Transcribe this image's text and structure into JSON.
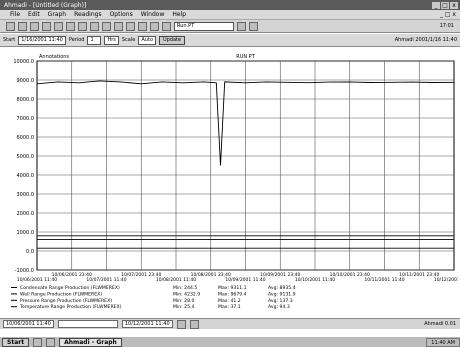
{
  "window": {
    "title": "Ahmadi - [Untitled (Graph)]",
    "minimize_label": "_",
    "maximize_label": "□",
    "close_label": "x"
  },
  "menu": {
    "items": [
      "File",
      "Edit",
      "Graph",
      "Readings",
      "Options",
      "Window",
      "Help"
    ],
    "right_label": "_ □ x"
  },
  "toolbar": {
    "point_field": "Run.PT",
    "time_label": "17:01"
  },
  "params": {
    "start_label": "Start",
    "start_value": "1/16/2001 11:40",
    "period_label": "Period",
    "period_value": "1",
    "period_unit": "Hrs",
    "scale_label": "Scale",
    "scale_value": "Auto",
    "update_button": "Update",
    "right_text": "Ahmadi 2001/1/16 11:40"
  },
  "chart_data": {
    "type": "line",
    "title": "RUN PT",
    "left_title": "Annotations",
    "ylim": [
      -1000,
      10000
    ],
    "yticks": [
      "10000.0",
      "9000.0",
      "8000.0",
      "7000.0",
      "6000.0",
      "5000.0",
      "4000.0",
      "3000.0",
      "2000.0",
      "1000.0",
      "0.0",
      "-1000.0"
    ],
    "xticks_top": [
      "10/06/2001 23:40",
      "10/07/2001 23:40",
      "10/08/2001 23:40",
      "10/09/2001 23:40",
      "10/10/2001 23:40",
      "10/11/2001 23:40"
    ],
    "xticks_bottom": [
      "10/06/2001 11:40",
      "10/07/2001 11:40",
      "10/08/2001 11:40",
      "10/09/2001 11:40",
      "10/10/2001 11:40",
      "10/11/2001 11:40",
      "10/12/2001 11:40"
    ],
    "series": [
      {
        "name": "Condensate Range Production (FLWMEREX)",
        "color": "#000000",
        "x": [
          0,
          0.05,
          0.1,
          0.15,
          0.2,
          0.25,
          0.3,
          0.35,
          0.4,
          0.43,
          0.44,
          0.45,
          0.5,
          0.55,
          0.6,
          0.65,
          0.7,
          0.75,
          0.8,
          0.85,
          0.9,
          0.95,
          1
        ],
        "values": [
          8800,
          8900,
          8850,
          8950,
          8900,
          8800,
          8900,
          8850,
          8900,
          8850,
          4500,
          8900,
          8850,
          8900,
          8880,
          8860,
          8890,
          8900,
          8870,
          8880,
          8890,
          8870,
          8880
        ]
      },
      {
        "name": "Well Range Production (FLWMEREX)",
        "color": "#000000",
        "x": [
          0,
          1
        ],
        "values": [
          800,
          800
        ]
      },
      {
        "name": "Pressure Range Production (FLWMEREX)",
        "color": "#000000",
        "x": [
          0,
          1
        ],
        "values": [
          600,
          600
        ]
      },
      {
        "name": "Temperature Range Production (FLWMEREX)",
        "color": "#000000",
        "x": [
          0,
          1
        ],
        "values": [
          150,
          150
        ]
      }
    ],
    "legend_rows": [
      {
        "name": "Condensate Range Production (FLWMEREX)",
        "min": "Min: 244.5",
        "max": "Max: 9311.1",
        "avg": "Avg: 8935.4"
      },
      {
        "name": "Well Range Production (FLWMEREX)",
        "min": "Min: 4232.9",
        "max": "Max: 9679.4",
        "avg": "Avg: 9131.9"
      },
      {
        "name": "Pressure Range Production (FLWMEREX)",
        "min": "Min: 28.0",
        "max": "Max: 41.2",
        "avg": "Avg: 137.3"
      },
      {
        "name": "Temperature Range Production (FLWMEREX)",
        "min": "Min: 25.4",
        "max": "Max: 37.1",
        "avg": "Avg: 94.3"
      }
    ]
  },
  "status": {
    "left_field": "10/06/2001 11:40",
    "combo_value": "",
    "time_field": "10/12/2001 11:40",
    "right_text": "Ahmadi  0.01"
  },
  "taskbar": {
    "start_label": "Start",
    "task_label": "Ahmadi - Graph",
    "tray_text": "11:40 AM"
  }
}
